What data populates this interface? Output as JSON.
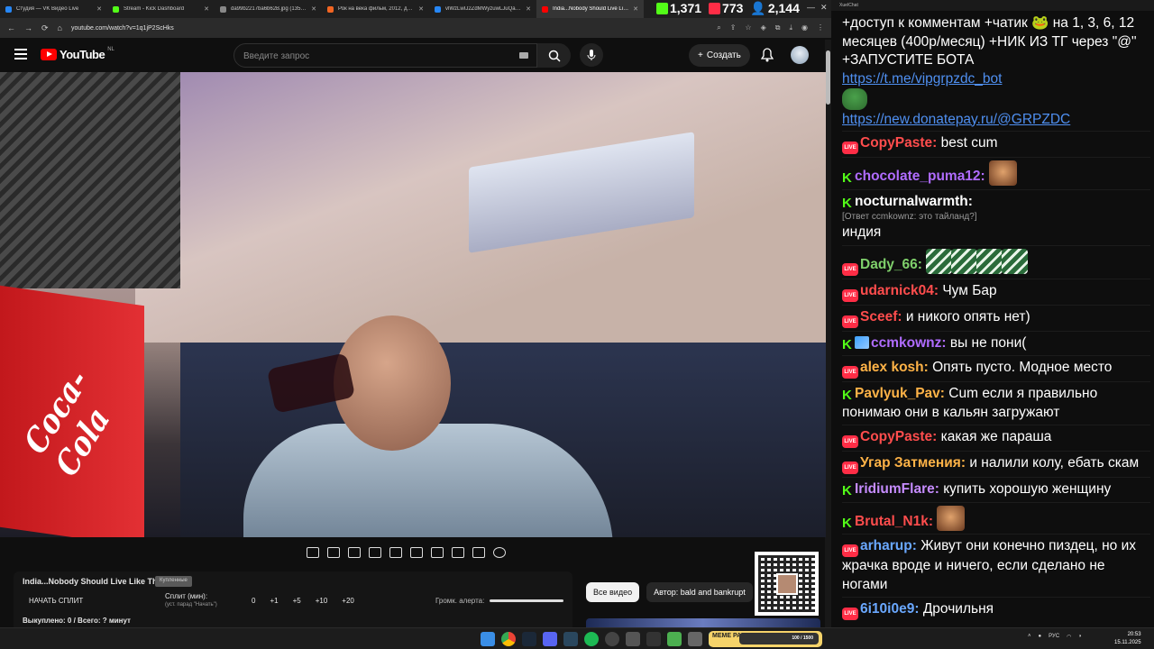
{
  "browser": {
    "tabs": [
      {
        "label": "Студия — VK Видео Live",
        "color": "#2787f5"
      },
      {
        "label": "Stream - Kick Dashboard",
        "color": "#53fc18"
      },
      {
        "label": "da99b2217ba6b62B.jpg (1358×...",
        "color": "#888888"
      },
      {
        "label": "Рок на века фильм, 2012, дата...",
        "color": "#f26522"
      },
      {
        "label": "vlWzLwIJ2ZdMWyzuwLJuQaD1...",
        "color": "#2787f5"
      },
      {
        "label": "India...Nobody Should Live Lik...",
        "color": "#ff0000"
      }
    ],
    "url": "youtube.com/watch?v=1q1jP2ScHks"
  },
  "stats": {
    "kick": "1,371",
    "live": "773",
    "viewers": "2,144"
  },
  "youtube": {
    "region": "NL",
    "logo_text": "YouTube",
    "search_placeholder": "Введите запрос",
    "create_label": "Создать"
  },
  "overlay": {
    "title": "India...Nobody Should Live Like This",
    "badge": "Купленные",
    "start_split": "НАЧАТЬ СПЛИТ",
    "split_label": "Сплит (мин):",
    "split_hint": "(уст. парад \"Начать\")",
    "numbers": [
      "0",
      "+1",
      "+5",
      "+10",
      "+20"
    ],
    "volume_label": "Громк. алерта:",
    "status": "Выкуплено: 0 / Всего: ? минут"
  },
  "chips": [
    "Все видео",
    "Автор: bald and bankrupt"
  ],
  "chat": {
    "header": "XueIChat",
    "pinned": {
      "text": "+доступ к комментам +чатик 🐸 на 1, 3, 6, 12 месяцев (400р/месяц) +НИК ИЗ ТГ через \"@\" +ЗАПУСТИТЕ БОТА",
      "link1": "https://t.me/vipgrpzdc_bot",
      "link2": "https://new.donatepay.ru/@GRPZDC"
    },
    "messages": [
      {
        "platform": "live",
        "nick": "CopyPaste:",
        "color": "#ff4d4d",
        "text": "best cum"
      },
      {
        "platform": "kick",
        "nick": "chocolate_puma12:",
        "color": "#b06cff",
        "text": ""
      },
      {
        "platform": "kick",
        "nick": "nocturnalwarmth:",
        "color": "#ffffff",
        "reply": "[Ответ ccmkownz: это тайланд?]",
        "text": "индия"
      },
      {
        "platform": "live",
        "nick": "Dady_66:",
        "color": "#7fd06b",
        "text": ""
      },
      {
        "platform": "live",
        "nick": "udarnick04:",
        "color": "#ff4d4d",
        "text": "Чум Бар"
      },
      {
        "platform": "live",
        "nick": "Sceef:",
        "color": "#ff4d4d",
        "text": "и никого опять нет)"
      },
      {
        "platform": "kick",
        "nick": "ccmkownz:",
        "color": "#b06cff",
        "text": "вы не пони("
      },
      {
        "platform": "live",
        "nick": "alex kosh:",
        "color": "#ffb347",
        "text": "Опять пусто. Модное место"
      },
      {
        "platform": "kick",
        "nick": "Pavlyuk_Pav:",
        "color": "#ffb347",
        "text": "Cum если я правильно понимаю они в кальян загружают"
      },
      {
        "platform": "live",
        "nick": "CopyPaste:",
        "color": "#ff4d4d",
        "text": "какая же параша"
      },
      {
        "platform": "live",
        "nick": "Угар Затмения:",
        "color": "#ffb347",
        "text": "и налили колу, ебать скам"
      },
      {
        "platform": "kick",
        "nick": "IridiumFlare:",
        "color": "#c68cff",
        "text": "купить хорошую женщину"
      },
      {
        "platform": "kick",
        "nick": "Brutal_N1k:",
        "color": "#ff4d4d",
        "text": ""
      },
      {
        "platform": "live",
        "nick": "arharup:",
        "color": "#6aa8ff",
        "text": "Живут они конечно пиздец, но их жрачка вроде и ничего, если сделано не ногами"
      },
      {
        "platform": "live",
        "nick": "6i10i0e9:",
        "color": "#6aa8ff",
        "text": "Дрочильня"
      }
    ]
  },
  "taskbar": {
    "meme_label": "MEME PARTY",
    "meme_counter": "100 / 1500",
    "lang": "РУС",
    "time": "20:53",
    "date": "15.11.2025"
  }
}
